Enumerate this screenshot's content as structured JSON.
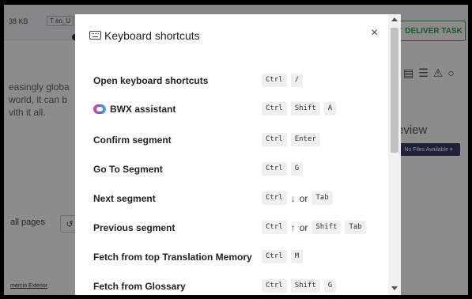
{
  "background": {
    "file_size": "38 KB",
    "lang_tag": "T en_U",
    "deliver_label": "DELIVER TASK",
    "text_lines": [
      "easingly globa",
      "world, it can b",
      "vith it all."
    ],
    "review": "eview",
    "no_files": "No Files Available",
    "all_pages": "all pages",
    "footer_link": "mercio Exterior"
  },
  "modal": {
    "title": "Keyboard shortcuts",
    "close_glyph": "×",
    "shortcuts": [
      {
        "label": "Open keyboard shortcuts",
        "keys": [
          "Ctrl",
          "/"
        ]
      },
      {
        "label": "BWX assistant",
        "keys": [
          "Ctrl",
          "Shift",
          "A"
        ]
      },
      {
        "label": "Confirm segment",
        "keys": [
          "Ctrl",
          "Enter"
        ]
      },
      {
        "label": "Go To Segment",
        "keys": [
          "Ctrl",
          "G"
        ]
      },
      {
        "label": "Next segment",
        "keys": [
          "Ctrl",
          "↓"
        ],
        "or": "or",
        "alt": [
          "Tab"
        ]
      },
      {
        "label": "Previous segment",
        "keys": [
          "Ctrl",
          "↑"
        ],
        "or": "or",
        "alt": [
          "Shift",
          "Tab"
        ]
      },
      {
        "label": "Fetch from top Translation Memory",
        "keys": [
          "Ctrl",
          "M"
        ]
      },
      {
        "label": "Fetch from Glossary",
        "keys": [
          "Ctrl",
          "Shift",
          "G"
        ]
      }
    ]
  },
  "icons": {
    "keyboard": "keyboard-icon",
    "close": "close-icon",
    "bwx": "bwx-assistant-icon"
  }
}
